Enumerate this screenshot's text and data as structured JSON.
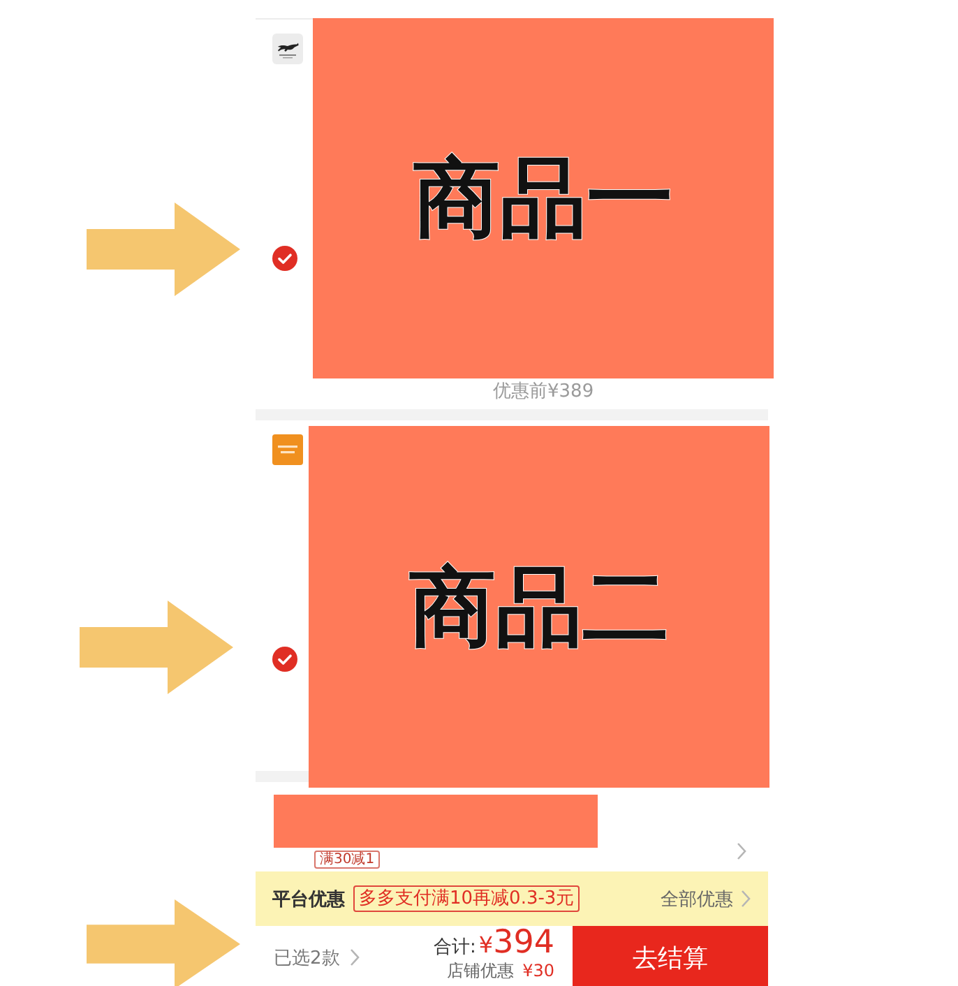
{
  "cart": {
    "items": [
      {
        "logo": {
          "kind": "emblem"
        },
        "selected": true,
        "arrow": true,
        "cover_label": "商品一",
        "price_note": "优惠前¥389"
      },
      {
        "logo": {
          "kind": "badge"
        },
        "selected": true,
        "arrow": true,
        "cover_label": "商品二"
      }
    ],
    "store_promo": {
      "covered": true,
      "tag": "满30减1"
    }
  },
  "platform_promo": {
    "label": "平台优惠",
    "offer": "多多支付满10再减0.3-3元",
    "link": "全部优惠"
  },
  "checkout_bar": {
    "arrow": true,
    "selected_count": "已选2款",
    "total_label": "合计:",
    "total": "¥394",
    "discount_label": "店铺优惠",
    "discount": "¥30",
    "button": "去结算"
  }
}
